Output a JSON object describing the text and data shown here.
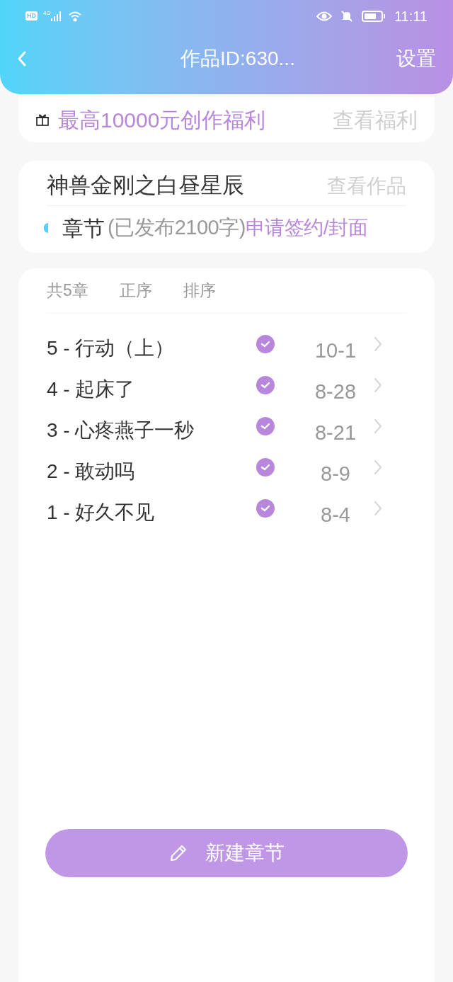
{
  "status_bar": {
    "hd": "HD",
    "network": "4G",
    "time": "11:11"
  },
  "header": {
    "title": "作品ID:630...",
    "action": "设置"
  },
  "benefit": {
    "text": "最高10000元创作福利",
    "link": "查看福利"
  },
  "work": {
    "title": "神兽金刚之白昼星辰",
    "link": "查看作品",
    "section": "章节",
    "published_info": "(已发布2100字)",
    "sign_link": "申请签约/封面"
  },
  "chapter_list": {
    "count": "共5章",
    "order": "正序",
    "sort": "排序",
    "chapters": [
      {
        "title": "5 - 行动（上）",
        "published": true,
        "date": "10-1"
      },
      {
        "title": "4 - 起床了",
        "published": true,
        "date": "8-28"
      },
      {
        "title": "3 - 心疼燕子一秒",
        "published": true,
        "date": "8-21"
      },
      {
        "title": "2 - 敢动吗",
        "published": true,
        "date": "8-9"
      },
      {
        "title": "1 - 好久不见",
        "published": true,
        "date": "8-4"
      }
    ]
  },
  "new_chapter_button": "新建章节"
}
